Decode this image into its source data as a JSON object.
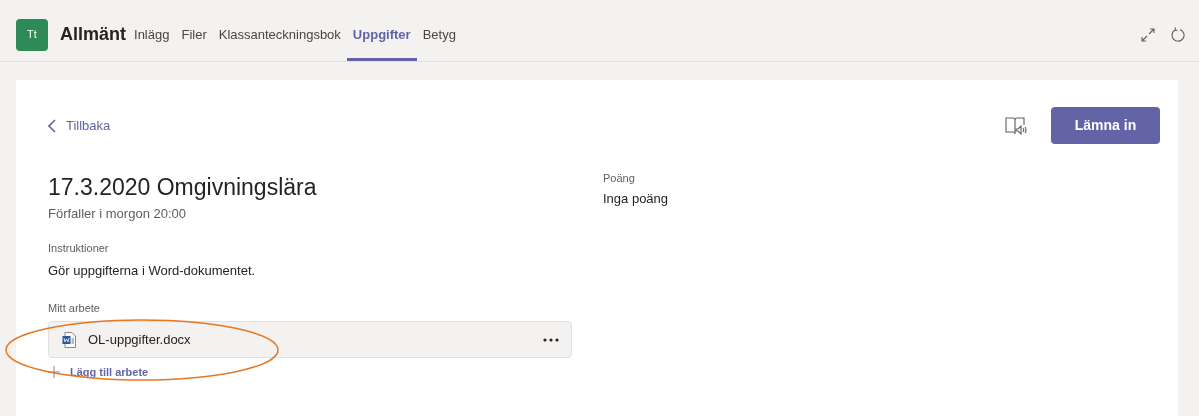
{
  "header": {
    "avatar": "Tt",
    "channel": "Allmänt",
    "tabs": [
      {
        "label": "Inlägg",
        "selected": false
      },
      {
        "label": "Filer",
        "selected": false
      },
      {
        "label": "Klassanteckningsbok",
        "selected": false
      },
      {
        "label": "Uppgifter",
        "selected": true
      },
      {
        "label": "Betyg",
        "selected": false
      }
    ]
  },
  "assignment": {
    "back": "Tillbaka",
    "submit_button": "Lämna in",
    "title": "17.3.2020 Omgivningslära",
    "due": "Förfaller i morgon 20:00",
    "instructions_label": "Instruktioner",
    "instructions": "Gör uppgifterna i Word-dokumentet.",
    "points_label": "Poäng",
    "points": "Inga poäng",
    "my_work_label": "Mitt arbete",
    "files": [
      {
        "name": "OL-uppgifter.docx"
      }
    ],
    "add_work": "Lägg till arbete"
  }
}
